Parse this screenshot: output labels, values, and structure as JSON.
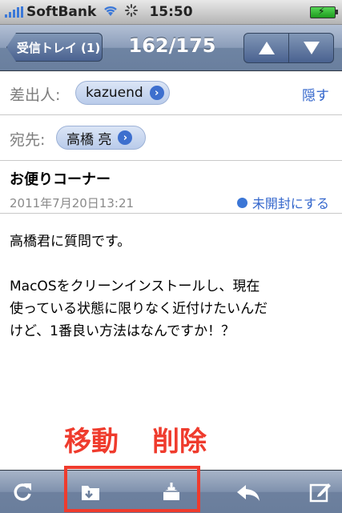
{
  "status": {
    "carrier": "SoftBank",
    "time": "15:50"
  },
  "nav": {
    "back_label": "受信トレイ (1)",
    "title": "162/175"
  },
  "from": {
    "label": "差出人:",
    "name": "kazuend",
    "hide": "隠す"
  },
  "to": {
    "label": "宛先:",
    "name": "高橋 亮"
  },
  "message": {
    "subject": "お便りコーナー",
    "date": "2011年7月20日13:21",
    "mark_unread": "未開封にする",
    "body": "高橋君に質問です。\n\nMacOSをクリーンインストールし、現在\n使っている状態に限りなく近付けたいんだ\nけど、1番良い方法はなんですか！？"
  },
  "annotation": {
    "move": "移動",
    "delete": "削除"
  },
  "icons": [
    "refresh-icon",
    "move-folder-icon",
    "trash-icon",
    "reply-icon",
    "compose-icon",
    "up-arrow-icon",
    "down-arrow-icon"
  ],
  "colors": {
    "accent": "#3366cc",
    "annotation": "#ef3b2d",
    "nav": "#6a7f9e"
  }
}
